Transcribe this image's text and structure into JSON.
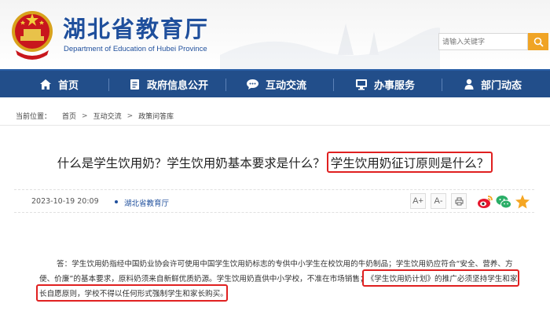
{
  "header": {
    "title": "湖北省教育厅",
    "subtitle": "Department of Education of Hubei Province",
    "search": {
      "placeholder": "请输入关键字"
    }
  },
  "nav": [
    {
      "label": "首页",
      "icon": "home-icon"
    },
    {
      "label": "政府信息公开",
      "icon": "document-icon"
    },
    {
      "label": "互动交流",
      "icon": "chat-icon"
    },
    {
      "label": "办事服务",
      "icon": "monitor-icon"
    },
    {
      "label": "部门动态",
      "icon": "person-icon"
    }
  ],
  "breadcrumb": {
    "prefix": "当前位置：",
    "items": [
      "首页",
      "互动交流",
      "政策问答库"
    ],
    "separator": ">"
  },
  "article": {
    "title_part1": "什么是学生饮用奶？学生饮用奶基本要求是什么？",
    "title_part2": "学生饮用奶征订原则是什么？",
    "date": "2023-10-19 20:09",
    "source": "湖北省教育厅",
    "font_increase": "A+",
    "font_decrease": "A-",
    "body_line1": "答：学生饮用奶指经中国奶业协会许可使用中国学生饮用奶标志的专供中小学生在校饮用的牛奶制品；学生饮用奶应符合“安全、营养、方",
    "body_line2a": "便、价廉”的基本要求，原料奶须来自新鲜优质奶源。学生饮用奶直供中小学校，不准在市场销售；",
    "body_line2b": "《学生饮用奶计划》的推广必须坚持学生和家",
    "body_line3": "长自愿原则，学校不得以任何形式强制学生和家长购买。"
  },
  "colors": {
    "nav_bg": "#224e8a",
    "brand_blue": "#1f4f9c",
    "search_button": "#f0a425",
    "highlight_red": "#e02020"
  },
  "share": [
    "weibo-icon",
    "wechat-icon",
    "more-share-icon"
  ]
}
